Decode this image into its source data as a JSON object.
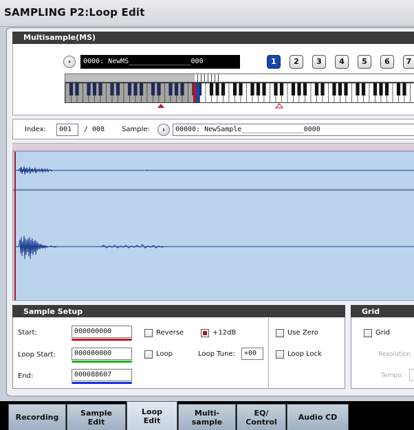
{
  "title": "SAMPLING P2:Loop Edit",
  "multisample": {
    "header": "Multisample(MS)",
    "selected_ms": "0000: NewMS_______________000",
    "bank_buttons": [
      "1",
      "2",
      "3",
      "4",
      "5",
      "6",
      "7"
    ],
    "selected_bank": "1"
  },
  "index_row": {
    "index_label": "Index:",
    "index_value": "001",
    "index_total": "/ 008",
    "sample_label": "Sample:",
    "sample_value": "00000: NewSample_______________0000"
  },
  "sample_setup": {
    "header": "Sample Setup",
    "start_label": "Start:",
    "start_value": "000000000",
    "loop_start_label": "Loop Start:",
    "loop_start_value": "000000000",
    "end_label": "End:",
    "end_value": "000088607",
    "reverse_label": "Reverse",
    "boost_label": "+12dB",
    "loop_label": "Loop",
    "loop_tune_label": "Loop Tune:",
    "loop_tune_value": "+00",
    "use_zero_label": "Use Zero",
    "loop_lock_label": "Loop Lock",
    "reverse_checked": false,
    "boost_checked": true,
    "loop_checked": false,
    "use_zero_checked": false,
    "loop_lock_checked": false
  },
  "grid": {
    "header": "Grid",
    "grid_label": "Grid",
    "grid_checked": false,
    "resolution_label": "Resolution",
    "tempo_label": "Tempo:"
  },
  "tabs": [
    {
      "label": "Recording",
      "active": false
    },
    {
      "label": "Sample\nEdit",
      "active": false
    },
    {
      "label": "Loop\nEdit",
      "active": true
    },
    {
      "label": "Multi-\nsample",
      "active": false
    },
    {
      "label": "EQ/\nControl",
      "active": false
    },
    {
      "label": "Audio CD",
      "active": false
    }
  ],
  "colors": {
    "start_underline": "#c1121f",
    "loop_start_underline": "#18b418",
    "end_underline": "#1432d8",
    "waveform": "#1d3d8f",
    "selected_bank": "#1747a8"
  }
}
